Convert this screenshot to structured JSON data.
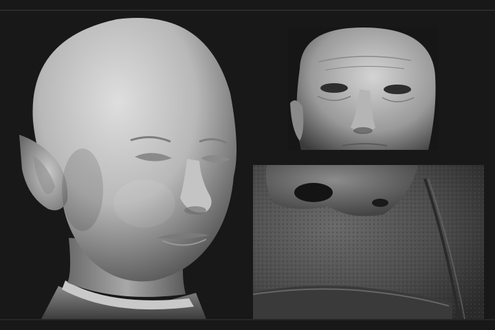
{
  "image": {
    "panels": [
      {
        "id": "main",
        "subject": "sculpt-head-clay"
      },
      {
        "id": "eyes",
        "subject": "textured-face-closeup"
      },
      {
        "id": "mouth",
        "subject": "skin-detail-closeup"
      }
    ],
    "colors": {
      "background": "#181818",
      "clay_light": "#d9d9d9",
      "clay_mid": "#a9a9a9",
      "clay_dark": "#5a5a5a",
      "skin_dark": "#3a3a3a"
    }
  }
}
